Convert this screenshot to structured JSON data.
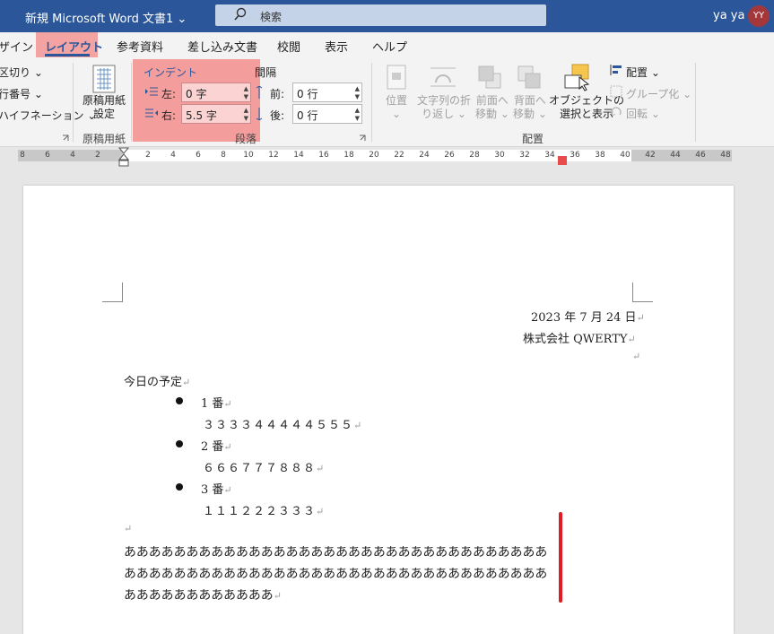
{
  "titlebar": {
    "title": "新規 Microsoft Word 文書1 ⌄",
    "search_placeholder": "検索",
    "user_name": "ya ya",
    "avatar_initials": "YY"
  },
  "tabs": [
    {
      "label": "ザイン"
    },
    {
      "label": "レイアウト"
    },
    {
      "label": "参考資料"
    },
    {
      "label": "差し込み文書"
    },
    {
      "label": "校閲"
    },
    {
      "label": "表示"
    },
    {
      "label": "ヘルプ"
    }
  ],
  "ribbon": {
    "page_setup_partial": [
      "区切り ⌄",
      "行番号 ⌄",
      "ハイフネーション ⌄"
    ],
    "genkou_button": "原稿用紙\n設定",
    "genkou_label": "原稿用紙",
    "indent_title": "インデント",
    "indent_left_label": "左:",
    "indent_left_value": "0 字",
    "indent_right_label": "右:",
    "indent_right_value": "5.5 字",
    "spacing_title": "間隔",
    "spacing_before_label": "前:",
    "spacing_before_value": "0 行",
    "spacing_after_label": "後:",
    "spacing_after_value": "0 行",
    "paragraph_label": "段落",
    "position": "位置\n⌄",
    "wrap_text": "文字列の折\nり返し ⌄",
    "bring_forward": "前面へ\n移動 ⌄",
    "send_backward": "背面へ\n移動 ⌄",
    "selection_pane": "オブジェクトの\n選択と表示",
    "align": "配置 ⌄",
    "group": "グループ化 ⌄",
    "rotate": "回転 ⌄",
    "arrange_label": "配置"
  },
  "ruler": {
    "left_ticks": [
      "8",
      "6",
      "4",
      "2"
    ],
    "right_ticks": [
      "2",
      "4",
      "6",
      "8",
      "10",
      "12",
      "14",
      "16",
      "18",
      "20",
      "22",
      "24",
      "26",
      "28",
      "30",
      "32",
      "34",
      "36",
      "38",
      "40",
      "42",
      "44",
      "46",
      "48"
    ]
  },
  "document": {
    "date": "2023 年 7 月 24 日",
    "company": "株式会社 QWERTY",
    "heading": "今日の予定",
    "items": [
      {
        "title": "1 番",
        "detail": "３３３３４４４４４５５５"
      },
      {
        "title": "2 番",
        "detail": "６６６７７７８８８"
      },
      {
        "title": "3 番",
        "detail": "１１１２２２３３３"
      }
    ],
    "body_lines": [
      "ああああああああああああああああああああああああああああああああああ",
      "ああああああああああああああああああああああああああああああああああ",
      "ああああああああああああ"
    ],
    "paragraph_mark": "↵"
  },
  "colors": {
    "brand": "#2b579a",
    "highlight": "#f47878",
    "red_bar": "#e01b24"
  }
}
